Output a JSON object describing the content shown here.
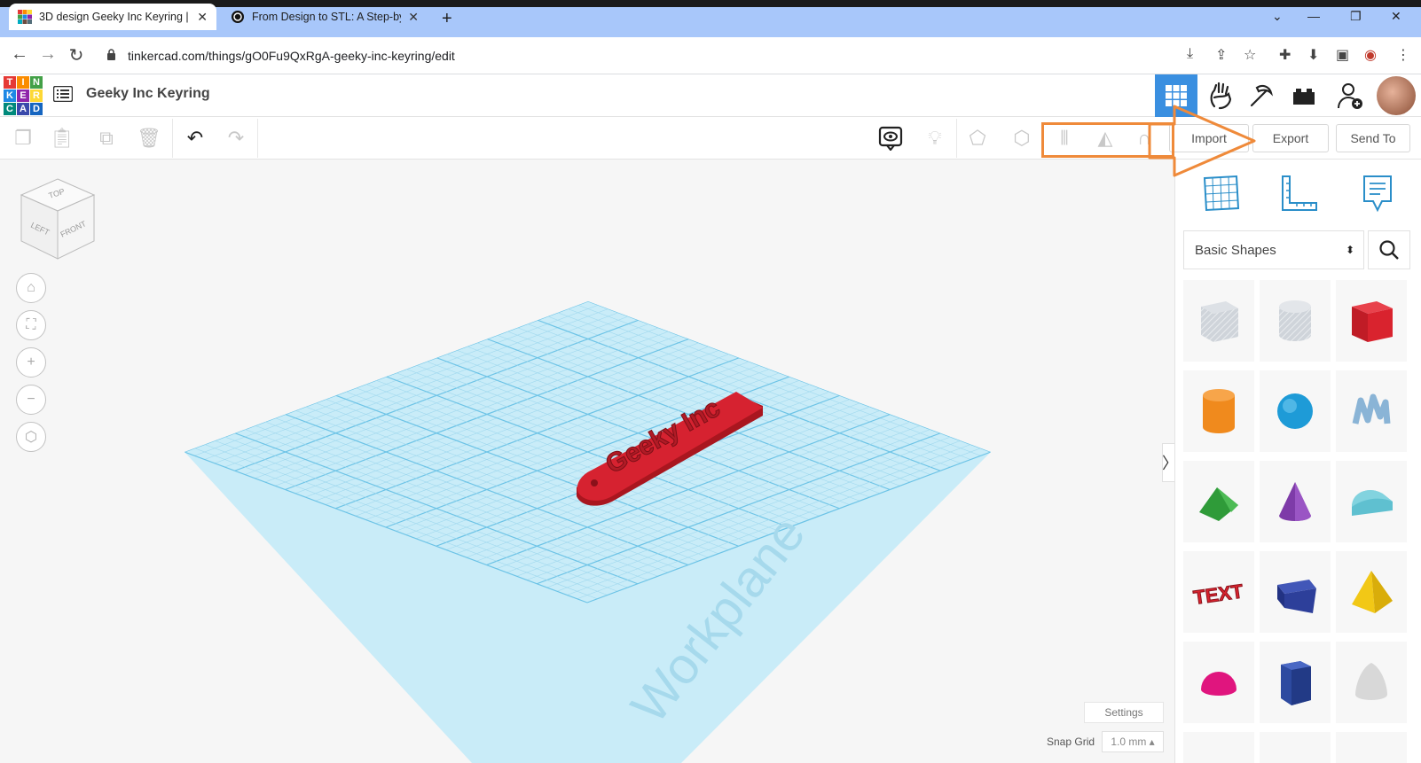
{
  "browser": {
    "tabs": [
      {
        "title": "3D design Geeky Inc Keyring | Tin",
        "active": true,
        "favicon": "tinkercad-icon"
      },
      {
        "title": "From Design to STL: A Step-by-St",
        "active": false,
        "favicon": "chatgpt-icon"
      }
    ],
    "url": "tinkercad.com/things/gO0Fu9QxRgA-geeky-inc-keyring/edit"
  },
  "header": {
    "logo_letters": [
      "T",
      "I",
      "N",
      "K",
      "E",
      "R",
      "C",
      "A",
      "D"
    ],
    "design_title": "Geeky Inc Keyring"
  },
  "toolbar": {
    "import_label": "Import",
    "export_label": "Export",
    "send_to_label": "Send To"
  },
  "viewcube": {
    "top": "TOP",
    "left": "LEFT",
    "front": "FRONT"
  },
  "workplane": {
    "watermark": "Workplane",
    "object_text": "Geeky Inc",
    "object_color": "#d62230",
    "grid_color": "#8fd2ec"
  },
  "panel": {
    "shape_category": "Basic Shapes",
    "shapes": [
      {
        "name": "box-hole",
        "color": "#cfd4da"
      },
      {
        "name": "cylinder-hole",
        "color": "#cfd4da"
      },
      {
        "name": "box",
        "color": "#d9232e"
      },
      {
        "name": "cylinder",
        "color": "#f08a1d"
      },
      {
        "name": "sphere",
        "color": "#1e9bd7"
      },
      {
        "name": "scribble",
        "color": "#8ab4d6"
      },
      {
        "name": "roof",
        "color": "#2f9b39"
      },
      {
        "name": "cone",
        "color": "#7e3ba8"
      },
      {
        "name": "round-roof",
        "color": "#5fc0d0"
      },
      {
        "name": "text",
        "color": "#d9232e"
      },
      {
        "name": "wedge-box",
        "color": "#2d3f9a"
      },
      {
        "name": "pyramid",
        "color": "#f2c816"
      },
      {
        "name": "half-sphere",
        "color": "#e0157e"
      },
      {
        "name": "polygon",
        "color": "#2d4aa0"
      },
      {
        "name": "paraboloid",
        "color": "#d8d8d8"
      }
    ],
    "text_shape_label": "TEXT"
  },
  "bottom": {
    "settings_label": "Settings",
    "snap_grid_label": "Snap Grid",
    "snap_grid_value": "1.0 mm ▴"
  },
  "colors": {
    "accent": "#3a8fe0",
    "annotation": "#ef8a3a"
  }
}
